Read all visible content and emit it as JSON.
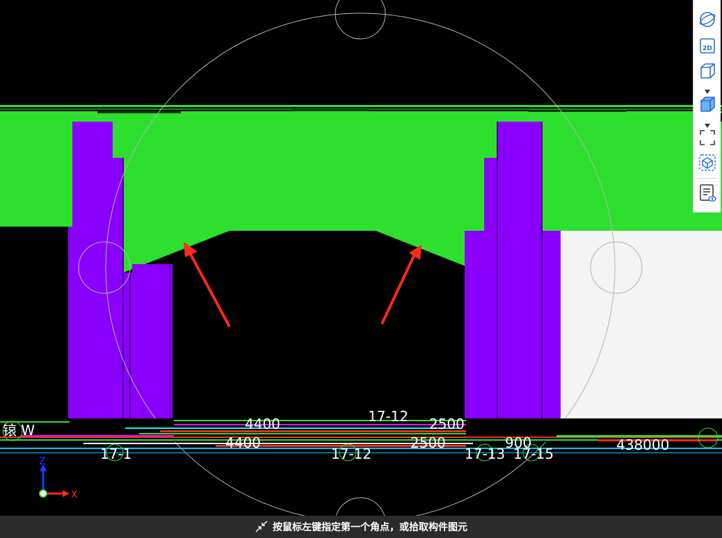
{
  "viewport": {
    "dimension_labels": {
      "dim_4400_top": "4400",
      "dim_17_12_top": "17-12",
      "dim_2500_top": "2500",
      "dim_4400_bottom": "4400",
      "dim_2500_bottom": "2500",
      "dim_900": "900",
      "dim_438000": "438000",
      "axis_17_1": "17-1",
      "axis_17_12": "17-12",
      "axis_17_13": "17-13",
      "axis_17_15": "17-15",
      "left_label": "锿 W"
    },
    "axis_indicator": {
      "z_label": "Z",
      "x_label": "X"
    }
  },
  "toolbar": {
    "items": [
      {
        "name": "orbit-icon",
        "label": ""
      },
      {
        "name": "2d-view-icon",
        "label": "2D"
      },
      {
        "name": "3d-view-icon",
        "label": ""
      },
      {
        "name": "shaded-view-icon",
        "label": ""
      },
      {
        "name": "zoom-extent-icon",
        "label": ""
      },
      {
        "name": "view-cube-icon",
        "label": ""
      },
      {
        "name": "properties-view-icon",
        "label": ""
      }
    ]
  },
  "status": {
    "message": "按鼠标左键指定第一个角点，或拾取构件图元"
  },
  "colors": {
    "beam_green": "#2ee02e",
    "column_purple": "#8a00ff",
    "annotation_red": "#ff2a1a",
    "background": "#000000",
    "status_bg": "#2b2b2b"
  }
}
